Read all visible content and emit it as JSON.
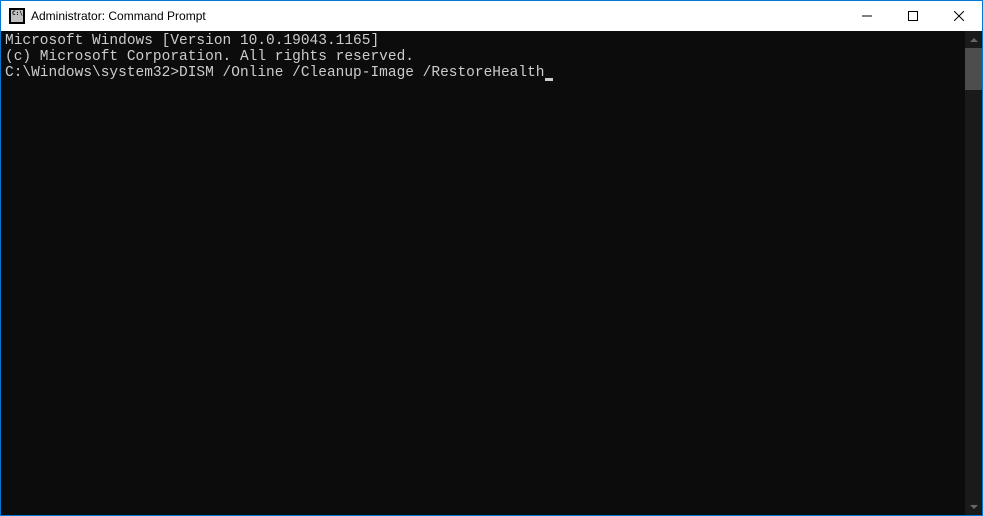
{
  "window": {
    "title": "Administrator: Command Prompt"
  },
  "console": {
    "line1": "Microsoft Windows [Version 10.0.19043.1165]",
    "line2": "(c) Microsoft Corporation. All rights reserved.",
    "blank": "",
    "prompt": "C:\\Windows\\system32>",
    "command": "DISM /Online /Cleanup-Image /RestoreHealth"
  }
}
